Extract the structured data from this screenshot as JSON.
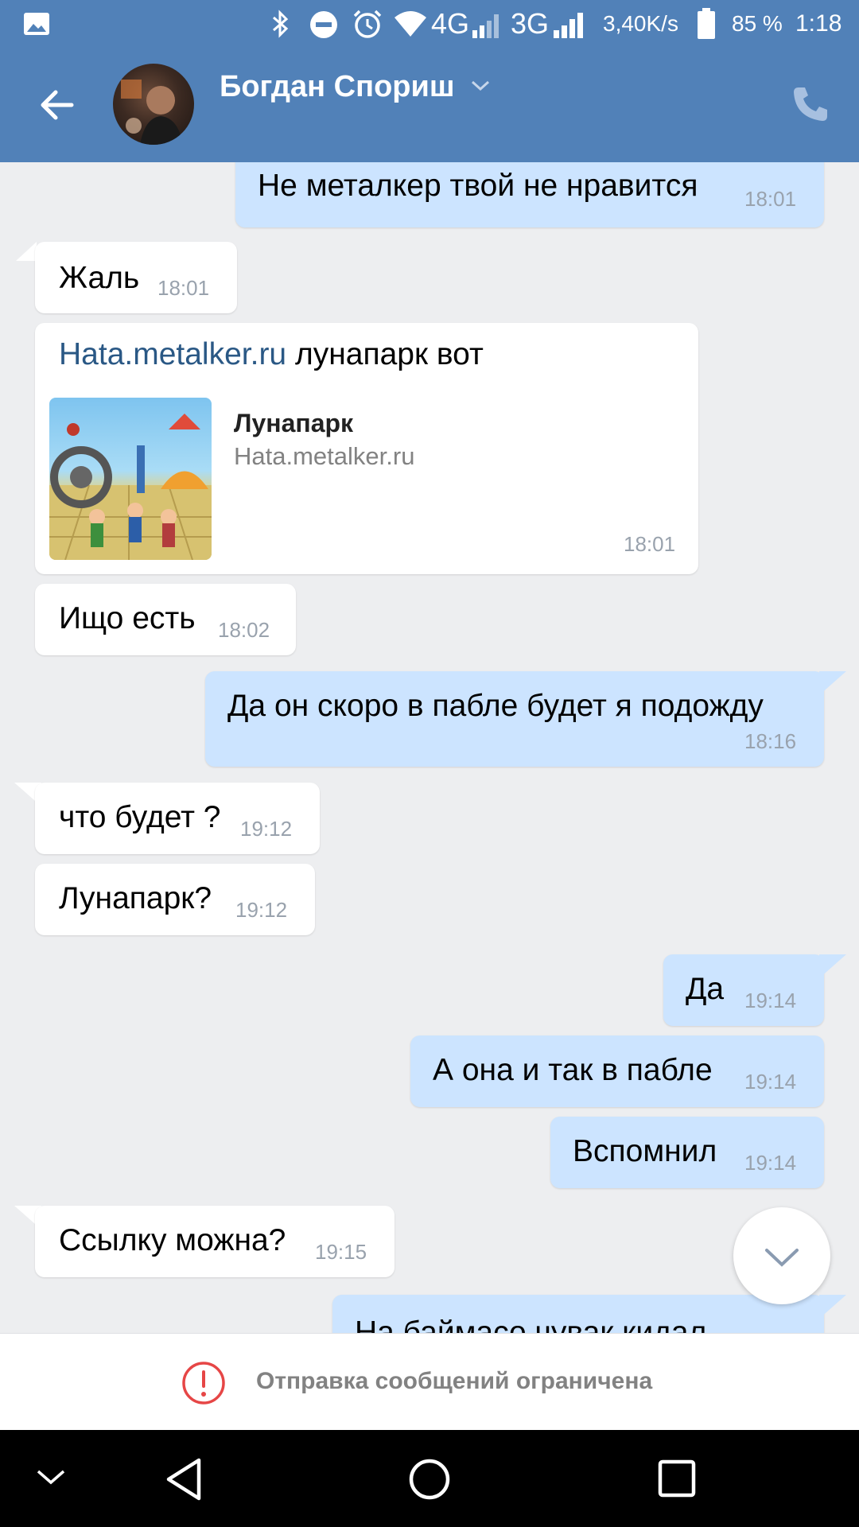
{
  "status_bar": {
    "network_4g": "4G",
    "network_3g": "3G",
    "speed": "3,40K/s",
    "battery": "85 %",
    "time": "1:18",
    "icons": [
      "image-icon",
      "bluetooth-icon",
      "dnd-icon",
      "alarm-icon",
      "wifi-icon",
      "signal-icon",
      "battery-icon"
    ]
  },
  "header": {
    "contact_name": "Богдан Спориш",
    "icons": [
      "back-arrow-icon",
      "chevron-down-icon",
      "phone-icon"
    ]
  },
  "messages": [
    {
      "side": "out",
      "text": "Не металкер твой не нравится",
      "time": "18:01"
    },
    {
      "side": "in",
      "text": "Жаль",
      "time": "18:01"
    },
    {
      "side": "in",
      "link": "Hata.metalker.ru",
      "text": "лунапарк вот",
      "card_title": "Лунапарк",
      "card_domain": "Hata.metalker.ru",
      "time": "18:01"
    },
    {
      "side": "in",
      "text": "Ищо есть",
      "time": "18:02"
    },
    {
      "side": "out",
      "text": "Да он скоро в пабле будет я подожду",
      "time": "18:16"
    },
    {
      "side": "in",
      "text": "что будет ?",
      "time": "19:12"
    },
    {
      "side": "in",
      "text": "Лунапарк?",
      "time": "19:12"
    },
    {
      "side": "out",
      "text": "Да",
      "time": "19:14"
    },
    {
      "side": "out",
      "text": "А она и так в пабле",
      "time": "19:14"
    },
    {
      "side": "out",
      "text": "Вспомнил",
      "time": "19:14"
    },
    {
      "side": "in",
      "text": "Ссылку можна?",
      "time": "19:15"
    },
    {
      "side": "out",
      "text": "На баймасо чувак кидал",
      "time": ""
    }
  ],
  "footer": {
    "restriction_text": "Отправка сообщений ограничена"
  },
  "colors": {
    "header_bg": "#5181b8",
    "chat_bg": "#edeef0",
    "incoming_bubble": "#ffffff",
    "outgoing_bubble": "#cce4ff",
    "link": "#2a5885",
    "time": "#99a2ad",
    "warning": "#e64646"
  }
}
